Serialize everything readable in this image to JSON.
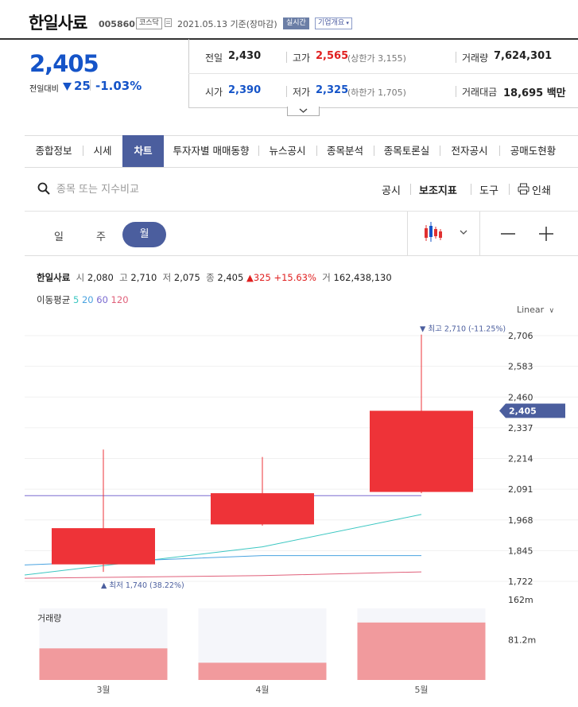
{
  "header": {
    "stock_name": "한일사료",
    "stock_code": "005860",
    "market": "코스닥",
    "date": "2021.05.13 기준(장마감)",
    "realtime": "실시간",
    "company_overview": "기업개요"
  },
  "price": {
    "current": "2,405",
    "diff_label": "전일대비",
    "diff_value": "25",
    "diff_percent": "-1.03%"
  },
  "summary": {
    "prev_label": "전일",
    "prev_value": "2,430",
    "high_label": "고가",
    "high_value": "2,565",
    "upper_limit": "(상한가 3,155)",
    "volume_label": "거래량",
    "volume_value": "7,624,301",
    "open_label": "시가",
    "open_value": "2,390",
    "low_label": "저가",
    "low_value": "2,325",
    "lower_limit": "(하한가 1,705)",
    "amount_label": "거래대금",
    "amount_value": "18,695 백만"
  },
  "tabs": [
    "종합정보",
    "시세",
    "차트",
    "투자자별 매매동향",
    "뉴스공시",
    "종목분석",
    "종목토론실",
    "전자공시",
    "공매도현황"
  ],
  "search": {
    "placeholder": "종목 또는 지수비교"
  },
  "tools": {
    "disclosure": "공시",
    "indicator": "보조지표",
    "tools": "도구",
    "print": "인쇄"
  },
  "periods": {
    "day": "일",
    "week": "주",
    "month": "월"
  },
  "info": {
    "name": "한일사료",
    "open_label": "시",
    "open": "2,080",
    "high_label": "고",
    "high": "2,710",
    "low_label": "저",
    "low": "2,075",
    "close_label": "종",
    "close": "2,405",
    "change": "▲325",
    "change_pct": "+15.63%",
    "volume_label": "거",
    "volume": "162,438,130"
  },
  "moving_average": {
    "label": "이동평균",
    "periods": [
      {
        "label": "5",
        "color": "#3cc7c2"
      },
      {
        "label": "20",
        "color": "#4aa3e0"
      },
      {
        "label": "60",
        "color": "#7a6ad0"
      },
      {
        "label": "120",
        "color": "#e0607a"
      }
    ]
  },
  "scale": "Linear",
  "chart_data": {
    "type": "candlestick",
    "categories": [
      "3월",
      "4월",
      "5월"
    ],
    "candles": [
      {
        "open": 1790,
        "high": 2250,
        "low": 1760,
        "close": 1935
      },
      {
        "open": 1950,
        "high": 2220,
        "low": 1945,
        "close": 2075
      },
      {
        "open": 2080,
        "high": 2710,
        "low": 2075,
        "close": 2405
      }
    ],
    "ma": [
      {
        "name": "5",
        "values": [
          1785,
          1860,
          1990
        ]
      },
      {
        "name": "20",
        "values": [
          1800,
          1825,
          1825
        ]
      },
      {
        "name": "60",
        "values": [
          2065,
          2065,
          2065
        ]
      },
      {
        "name": "120",
        "values": [
          1738,
          1745,
          1760
        ]
      }
    ],
    "y_ticks": [
      "2,706",
      "2,583",
      "2,460",
      "2,337",
      "2,214",
      "2,091",
      "1,968",
      "1,845",
      "1,722"
    ],
    "y_tick_values": [
      2706,
      2583,
      2460,
      2337,
      2214,
      2091,
      1968,
      1845,
      1722
    ],
    "ylim": [
      1700,
      2740
    ],
    "current_label": "2,405",
    "current_value": 2405,
    "max_annotation": "▼ 최고 2,710 (-11.25%)",
    "min_annotation": "▲ 최저 1,740 (38.22%)",
    "volume": {
      "label": "거래량",
      "values": [
        55000000,
        30000000,
        100000000
      ],
      "ylim": [
        0,
        162000000
      ],
      "y_ticks": [
        "162m",
        "81.2m"
      ],
      "y_tick_values": [
        140000000,
        70000000
      ]
    }
  }
}
